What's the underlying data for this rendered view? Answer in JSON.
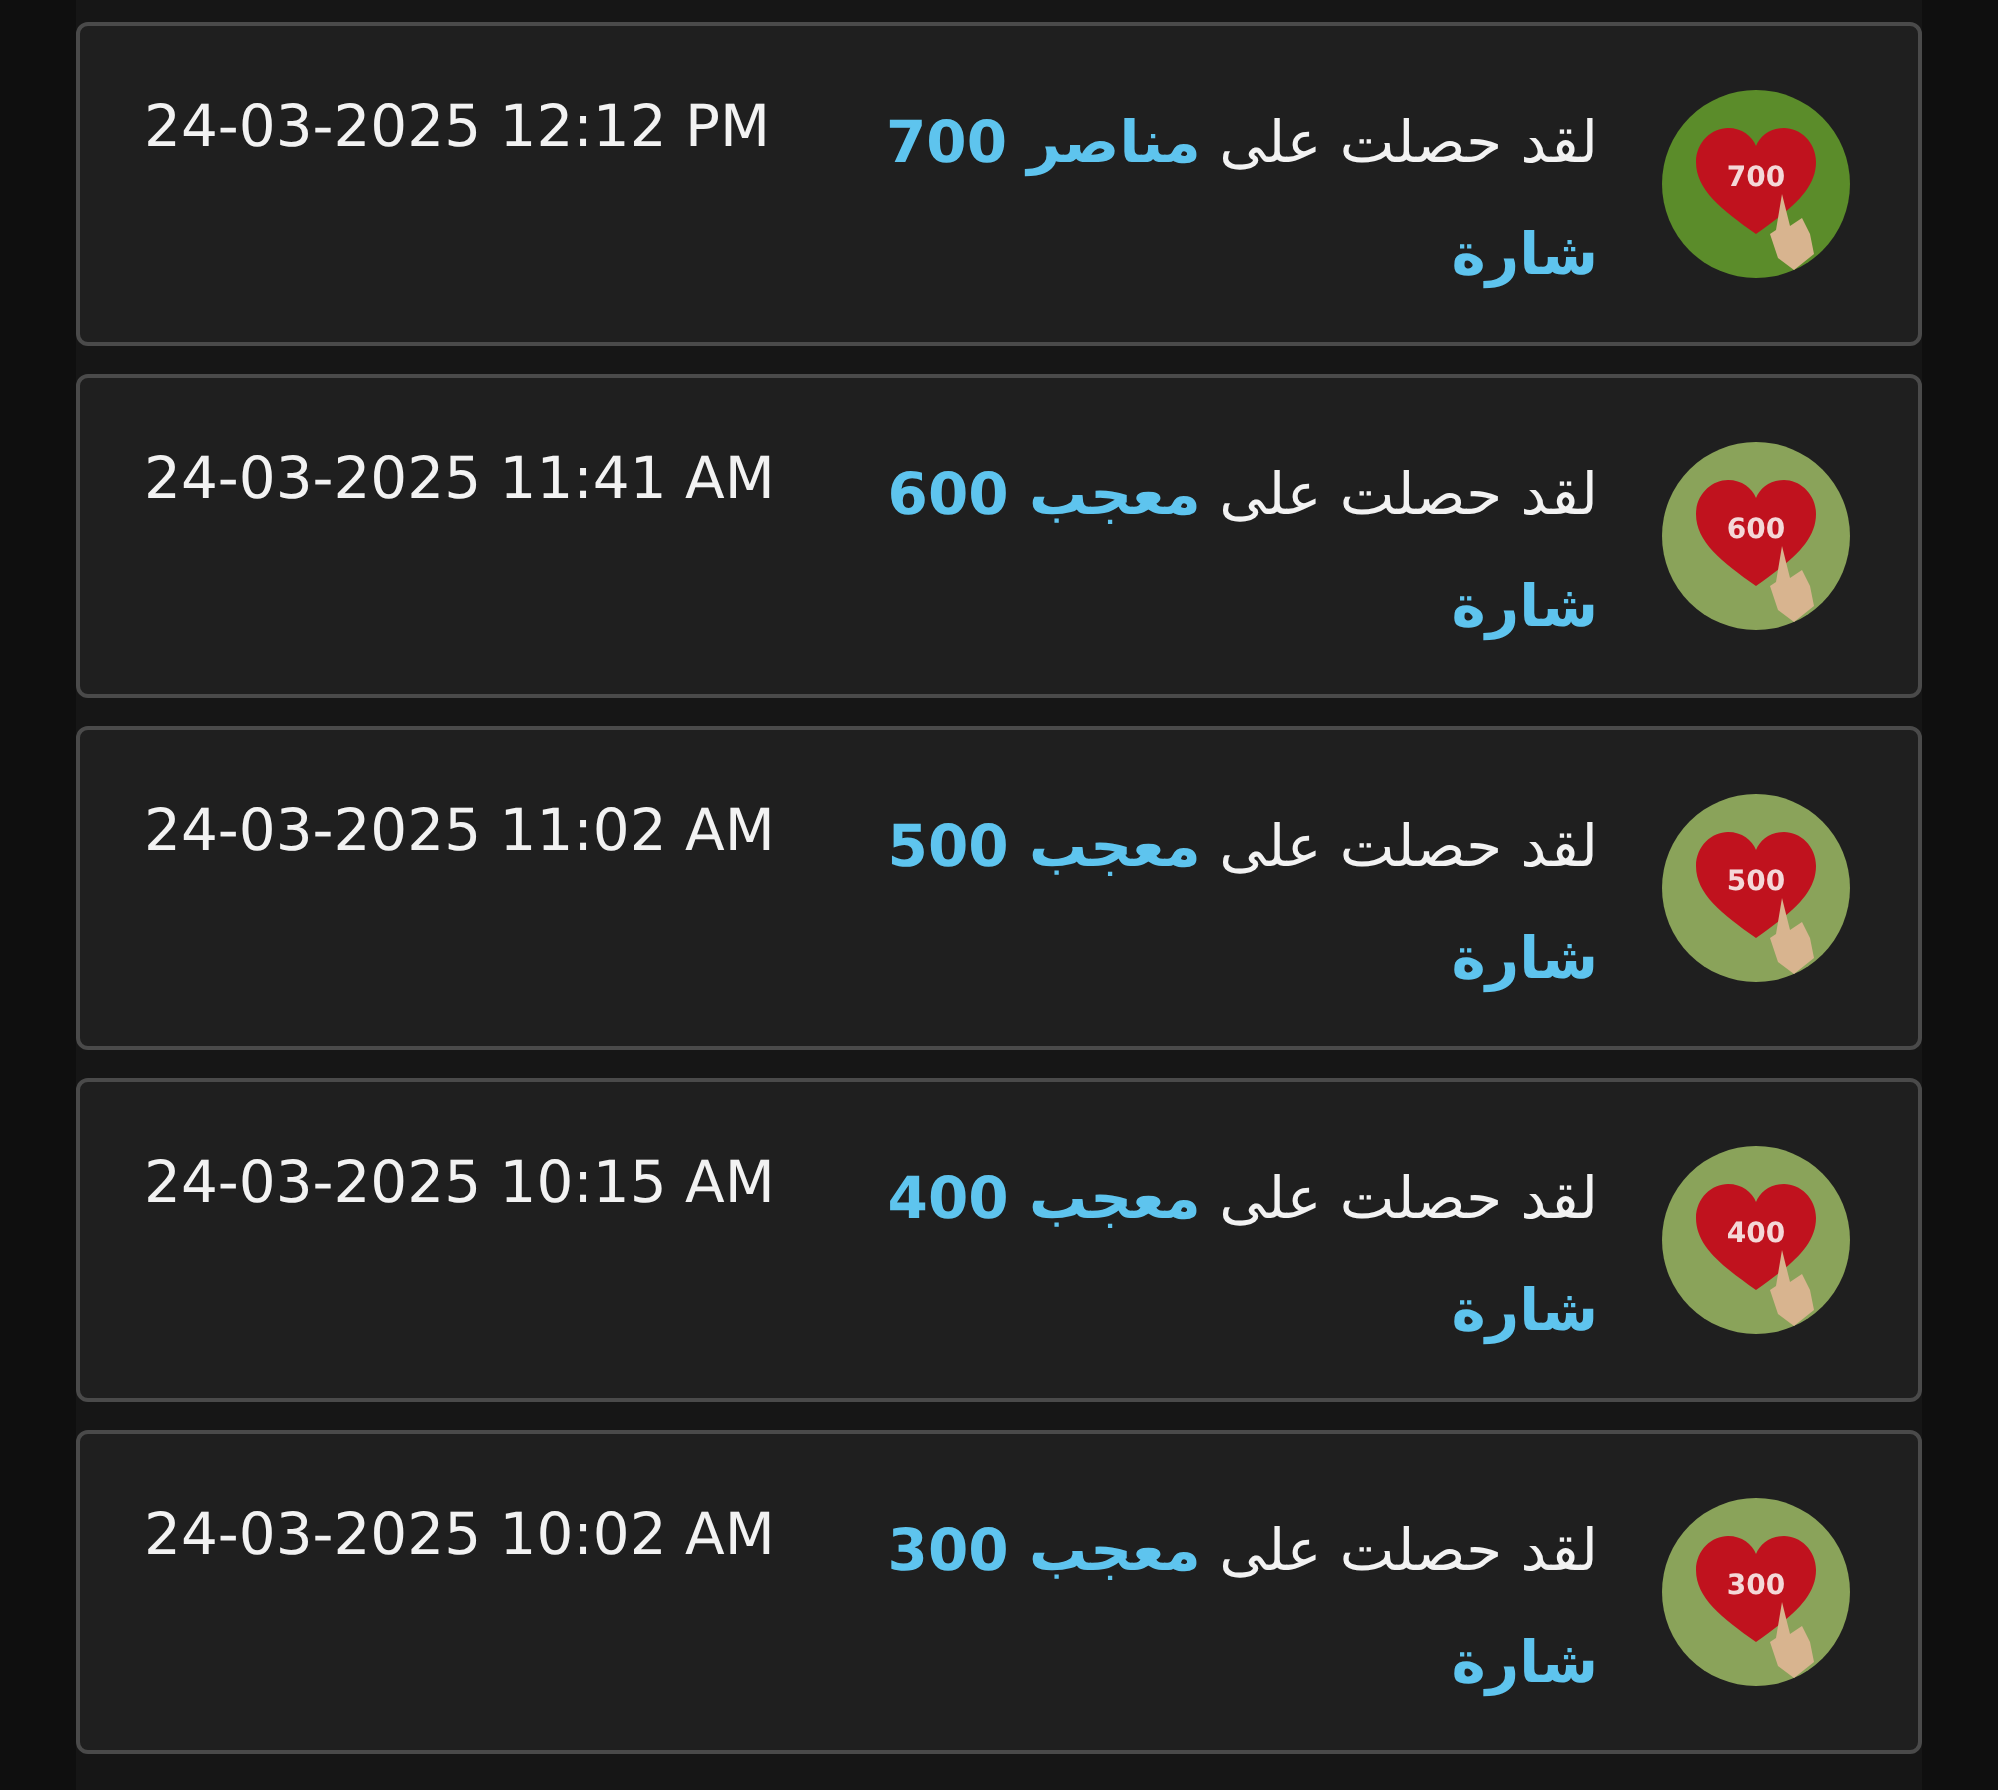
{
  "notifications": [
    {
      "badge": "700",
      "color": "#5b8c2a",
      "message": "لقد حصلت على **مناصر 700 شارة**",
      "time": "24-03-2025 12:12 PM"
    },
    {
      "badge": "600",
      "color": "#8aa35a",
      "message": "لقد حصلت على **معجب 600 شارة**",
      "time": "24-03-2025 11:41 AM"
    },
    {
      "badge": "500",
      "color": "#8aa35a",
      "message": "لقد حصلت على **معجب 500 شارة**",
      "time": "24-03-2025 11:02 AM"
    },
    {
      "badge": "400",
      "color": "#8aa35a",
      "message": "لقد حصلت على **معجب 400 شارة**",
      "time": "24-03-2025 10:15 AM"
    },
    {
      "badge": "300",
      "color": "#8aa35a",
      "message": "لقد حصلت على **معجب 300 شارة**",
      "time": "24-03-2025 10:02 AM"
    }
  ]
}
